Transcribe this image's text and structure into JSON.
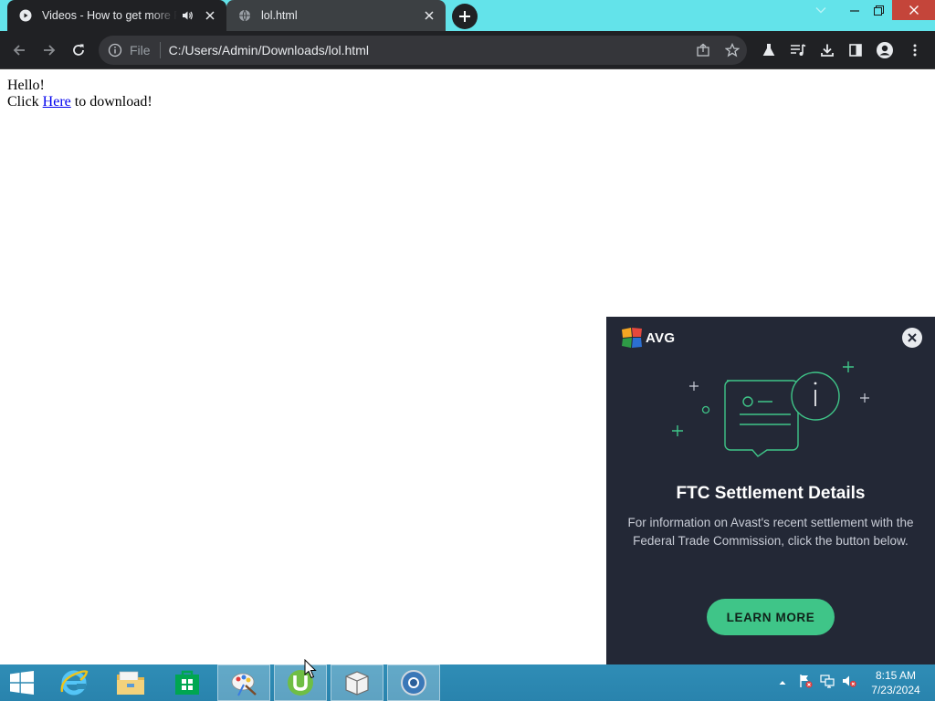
{
  "browser": {
    "tabs": [
      {
        "title": "Videos - How to get more R",
        "active": true
      },
      {
        "title": "lol.html",
        "active": false
      }
    ],
    "address": {
      "scheme_label": "File",
      "url": "C:/Users/Admin/Downloads/lol.html"
    }
  },
  "page": {
    "greeting": "Hello!",
    "line_prefix": "Click ",
    "link_text": "Here",
    "line_suffix": " to download!"
  },
  "popup": {
    "brand": "AVG",
    "title": "FTC Settlement Details",
    "body": "For information on Avast's recent settlement with the Federal Trade Commission, click the button below.",
    "button": "LEARN MORE",
    "accent": "#3fc588"
  },
  "taskbar": {
    "time": "8:15 AM",
    "date": "7/23/2024"
  },
  "colors": {
    "tab_strip": "#63e3ea",
    "toolbar": "#202124",
    "popup_bg": "#232836",
    "taskbar": "#2f8db6"
  }
}
